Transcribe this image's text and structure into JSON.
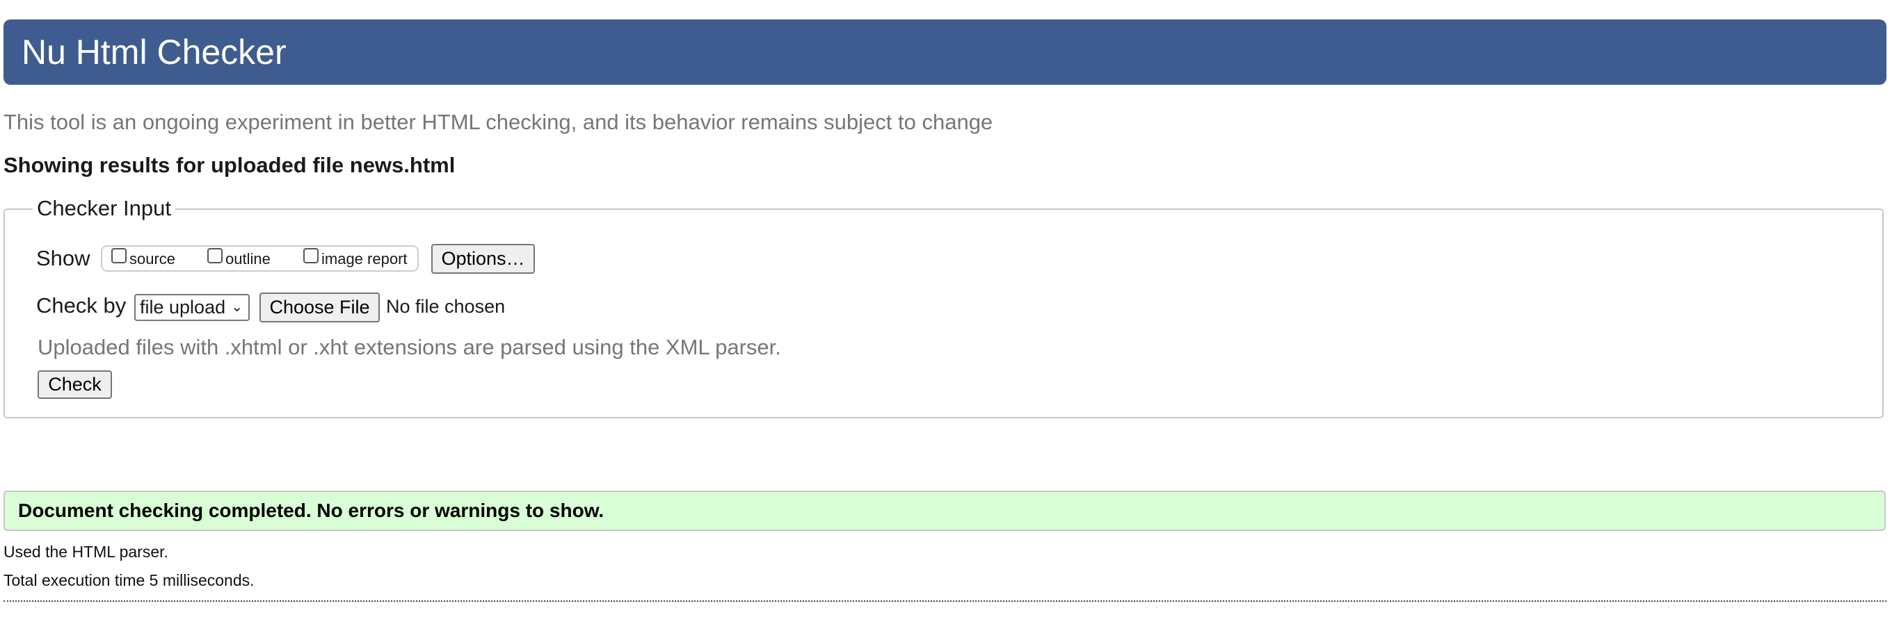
{
  "header": {
    "title": "Nu Html Checker",
    "bg_color": "#3e5c8f"
  },
  "tagline": "This tool is an ongoing experiment in better HTML checking, and its behavior remains subject to change",
  "results_heading": "Showing results for uploaded file news.html",
  "checker_input": {
    "legend": "Checker Input",
    "show_label": "Show",
    "show_options": [
      {
        "label": "source",
        "checked": false
      },
      {
        "label": "outline",
        "checked": false
      },
      {
        "label": "image report",
        "checked": false
      }
    ],
    "options_button": "Options…",
    "check_by_label": "Check by",
    "check_by_selected": "file upload",
    "choose_file_button": "Choose File",
    "file_status": "No file chosen",
    "note": "Uploaded files with .xhtml or .xht extensions are parsed using the XML parser.",
    "check_button": "Check"
  },
  "result": {
    "message": "Document checking completed. No errors or warnings to show.",
    "bg_color": "#d9fdd4",
    "parser_info": "Used the HTML parser.",
    "execution_time": "Total execution time 5 milliseconds."
  }
}
